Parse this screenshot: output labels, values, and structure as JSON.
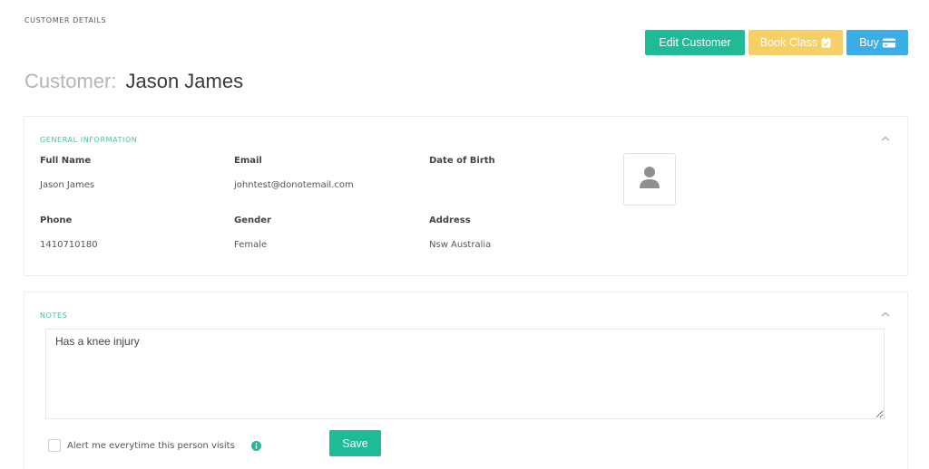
{
  "breadcrumb": "CUSTOMER DETAILS",
  "header": {
    "title_label": "Customer:",
    "customer_name": "Jason James"
  },
  "actions": {
    "edit_label": "Edit Customer",
    "book_label": "Book Class",
    "book_icon": "calendar-check-icon",
    "buy_label": "Buy",
    "buy_icon": "credit-card-icon",
    "colors": {
      "edit": "#1fbb96",
      "book": "#f6cf65",
      "buy": "#3baee8"
    }
  },
  "general": {
    "heading": "GENERAL INFORMATION",
    "collapse_icon": "chevron-up-icon",
    "fields": [
      {
        "label": "Full Name",
        "value": "Jason James"
      },
      {
        "label": "Email",
        "value": "johntest@donotemail.com"
      },
      {
        "label": "Date of Birth",
        "value": ""
      },
      {
        "label": "Phone",
        "value": "1410710180"
      },
      {
        "label": "Gender",
        "value": "Female"
      },
      {
        "label": "Address",
        "value": "Nsw Australia"
      }
    ],
    "avatar_icon": "user-placeholder-icon"
  },
  "notes": {
    "heading": "NOTES",
    "collapse_icon": "chevron-up-icon",
    "text": "Has a knee injury",
    "alert_label": "Alert me everytime this person visits",
    "alert_checked": false,
    "info_icon": "info-icon",
    "save_label": "Save"
  },
  "accent_color": "#3cc79e"
}
